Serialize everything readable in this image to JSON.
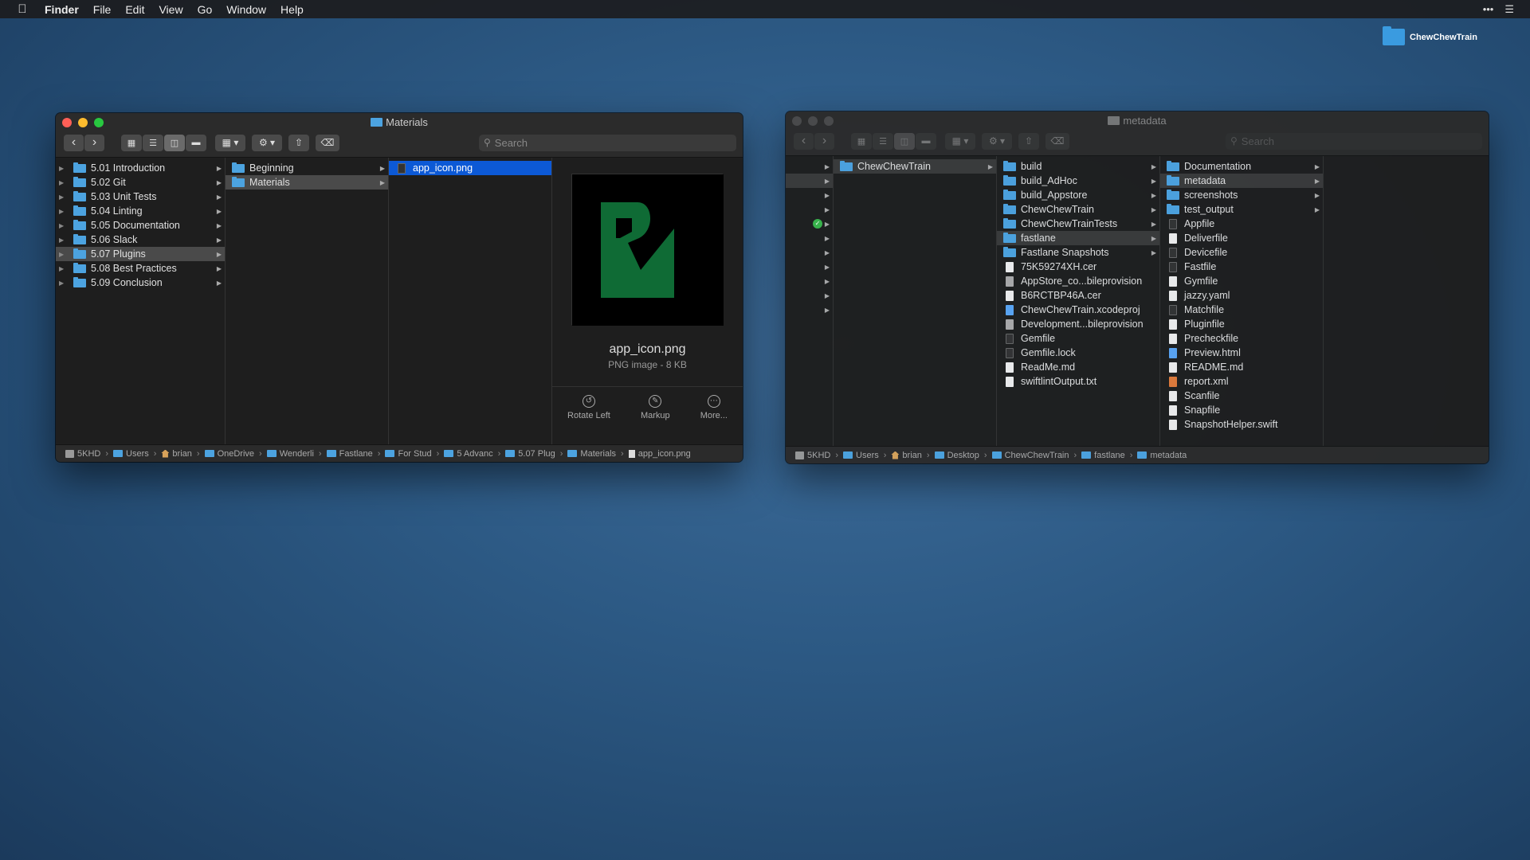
{
  "menubar": {
    "app": "Finder",
    "items": [
      "File",
      "Edit",
      "View",
      "Go",
      "Window",
      "Help"
    ]
  },
  "desktop": {
    "icon_label": "ChewChewTrain"
  },
  "window1": {
    "title": "Materials",
    "search_placeholder": "Search",
    "col1": [
      {
        "label": "5.01 Introduction"
      },
      {
        "label": "5.02 Git"
      },
      {
        "label": "5.03 Unit Tests"
      },
      {
        "label": "5.04 Linting"
      },
      {
        "label": "5.05 Documentation"
      },
      {
        "label": "5.06 Slack"
      },
      {
        "label": "5.07 Plugins"
      },
      {
        "label": "5.08 Best Practices"
      },
      {
        "label": "5.09 Conclusion"
      }
    ],
    "col2": [
      {
        "label": "Beginning"
      },
      {
        "label": "Materials"
      }
    ],
    "col3": [
      {
        "label": "app_icon.png"
      }
    ],
    "preview": {
      "name": "app_icon.png",
      "info": "PNG image - 8 KB",
      "actions": [
        "Rotate Left",
        "Markup",
        "More..."
      ]
    },
    "path": [
      "5KHD",
      "Users",
      "brian",
      "OneDrive",
      "Wenderli",
      "Fastlane",
      "For Stud",
      "5 Advanc",
      "5.07 Plug",
      "Materials",
      "app_icon.png"
    ]
  },
  "window2": {
    "title": "metadata",
    "search_placeholder": "Search",
    "col2": [
      {
        "label": "ChewChewTrain"
      }
    ],
    "col3": [
      {
        "label": "build"
      },
      {
        "label": "build_AdHoc"
      },
      {
        "label": "build_Appstore"
      },
      {
        "label": "ChewChewTrain"
      },
      {
        "label": "ChewChewTrainTests"
      },
      {
        "label": "fastlane"
      },
      {
        "label": "Fastlane Snapshots"
      },
      {
        "label": "75K59274XH.cer"
      },
      {
        "label": "AppStore_co...bileprovision"
      },
      {
        "label": "B6RCTBP46A.cer"
      },
      {
        "label": "ChewChewTrain.xcodeproj"
      },
      {
        "label": "Development...bileprovision"
      },
      {
        "label": "Gemfile"
      },
      {
        "label": "Gemfile.lock"
      },
      {
        "label": "ReadMe.md"
      },
      {
        "label": "swiftlintOutput.txt"
      }
    ],
    "col4": [
      {
        "label": "Documentation"
      },
      {
        "label": "metadata"
      },
      {
        "label": "screenshots"
      },
      {
        "label": "test_output"
      },
      {
        "label": "Appfile"
      },
      {
        "label": "Deliverfile"
      },
      {
        "label": "Devicefile"
      },
      {
        "label": "Fastfile"
      },
      {
        "label": "Gymfile"
      },
      {
        "label": "jazzy.yaml"
      },
      {
        "label": "Matchfile"
      },
      {
        "label": "Pluginfile"
      },
      {
        "label": "Precheckfile"
      },
      {
        "label": "Preview.html"
      },
      {
        "label": "README.md"
      },
      {
        "label": "report.xml"
      },
      {
        "label": "Scanfile"
      },
      {
        "label": "Snapfile"
      },
      {
        "label": "SnapshotHelper.swift"
      }
    ],
    "path": [
      "5KHD",
      "Users",
      "brian",
      "Desktop",
      "ChewChewTrain",
      "fastlane",
      "metadata"
    ]
  }
}
